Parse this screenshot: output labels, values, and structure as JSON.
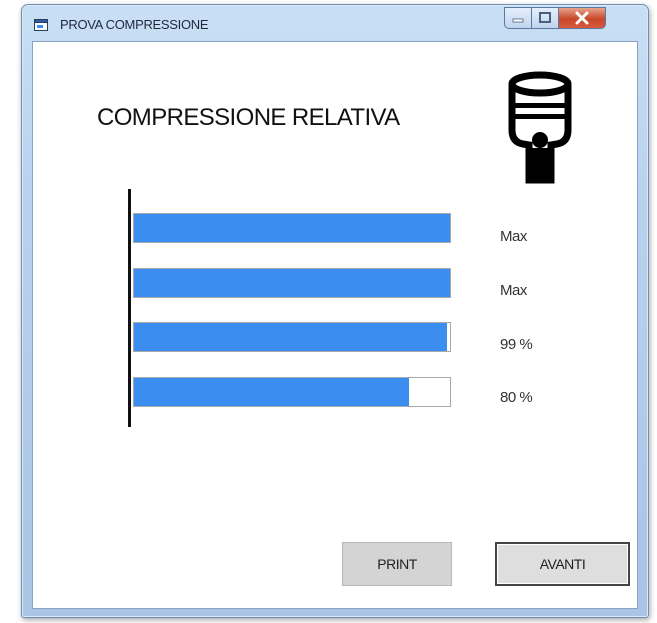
{
  "window": {
    "title": "PROVA COMPRESSIONE",
    "title_icon": "app-window-icon",
    "controls": [
      "minimize-icon",
      "maximize-icon",
      "close-icon"
    ]
  },
  "main": {
    "heading": "COMPRESSIONE RELATIVA",
    "logo_icon": "piston-icon",
    "bars": [
      {
        "label": "Max",
        "fill_percent": 100
      },
      {
        "label": "Max",
        "fill_percent": 100
      },
      {
        "label": "99 %",
        "fill_percent": 99
      },
      {
        "label": "80 %",
        "fill_percent": 87
      }
    ],
    "bar_color": "#3b8ef0"
  },
  "buttons": {
    "print_label": "PRINT",
    "next_label": "AVANTI"
  }
}
